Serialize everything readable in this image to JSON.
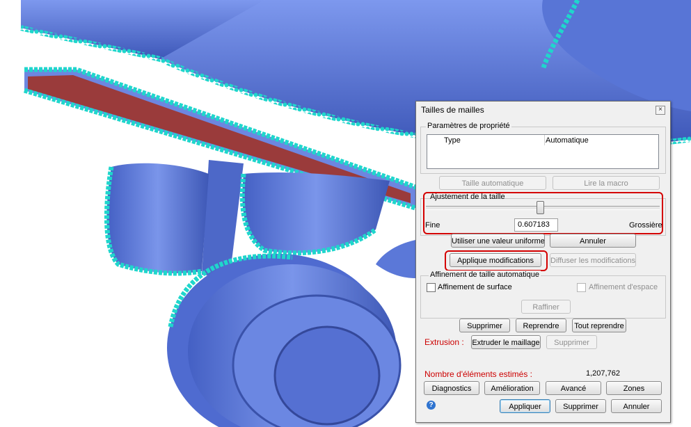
{
  "dialog": {
    "title": "Tailles de mailles",
    "close_glyph": "×",
    "props_group": {
      "legend": "Paramètres de propriété",
      "col_type": "Type",
      "col_value": "Automatique"
    },
    "auto_size_button": "Taille automatique",
    "read_macro_button": "Lire la macro",
    "size_group": {
      "legend": "Ajustement de la taille",
      "slider_level": 0.49,
      "label_fine": "Fine",
      "value": "0.607183",
      "label_coarse": "Grossière"
    },
    "uniform_button": "Utiliser une valeur uniforme",
    "cancel_button": "Annuler",
    "apply_changes_button": "Applique modifications",
    "spread_changes_button": "Diffuser les modifications",
    "refine_group": {
      "legend": "Affinement de taille automatique",
      "surface_label": "Affinement de surface",
      "surface_checked": false,
      "space_label": "Affinement d'espace",
      "space_checked": false,
      "refine_button": "Raffiner"
    },
    "delete_button": "Supprimer",
    "redo_button": "Reprendre",
    "redo_all_button": "Tout reprendre",
    "extrusion": {
      "label": "Extrusion :",
      "extrude_button": "Extruder le maillage",
      "delete_button": "Supprimer"
    },
    "estimate": {
      "label": "Nombre d'éléments estimés :",
      "value": "1,207,762"
    },
    "tabs": {
      "diagnostics": "Diagnostics",
      "improvement": "Amélioration",
      "advanced": "Avancé",
      "zones": "Zones"
    },
    "help_glyph": "?",
    "footer": {
      "apply": "Appliquer",
      "delete": "Supprimer",
      "cancel": "Annuler"
    }
  },
  "colors": {
    "model_blue": "#5a78d8",
    "mesh_cyan": "#1fd6cc",
    "section_red": "#9a3b3b",
    "highlight_red": "#d40000",
    "error_text": "#cc0000"
  }
}
